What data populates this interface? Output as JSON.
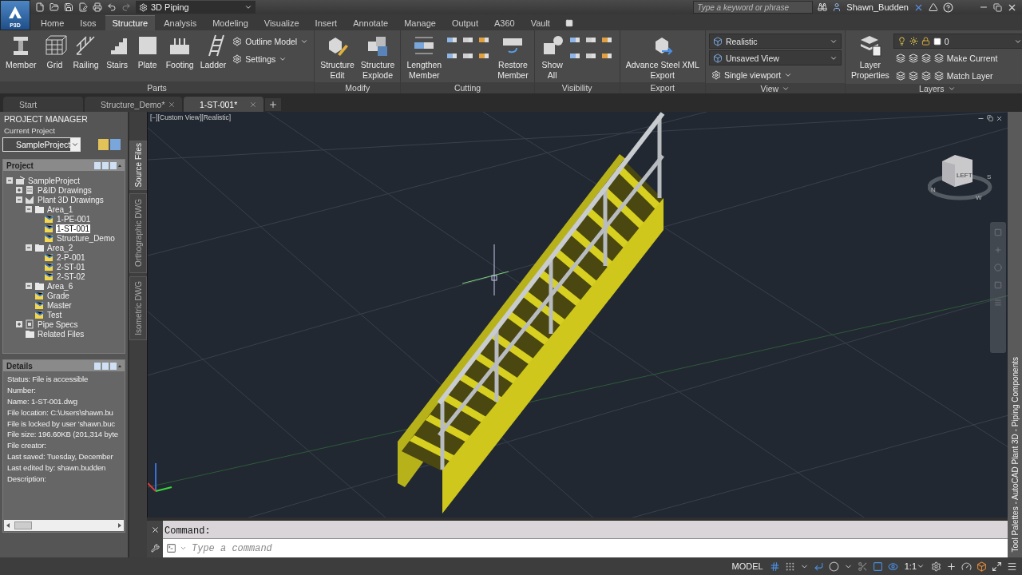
{
  "title_bar": {
    "app_badge": "P3D",
    "workspace": "3D Piping",
    "search_placeholder": "Type a keyword or phrase",
    "user": "Shawn_Budden"
  },
  "ribbon_tabs": [
    {
      "label": "Home",
      "selected": false
    },
    {
      "label": "Isos",
      "selected": false
    },
    {
      "label": "Structure",
      "selected": true
    },
    {
      "label": "Analysis",
      "selected": false
    },
    {
      "label": "Modeling",
      "selected": false
    },
    {
      "label": "Visualize",
      "selected": false
    },
    {
      "label": "Insert",
      "selected": false
    },
    {
      "label": "Annotate",
      "selected": false
    },
    {
      "label": "Manage",
      "selected": false
    },
    {
      "label": "Output",
      "selected": false
    },
    {
      "label": "A360",
      "selected": false
    },
    {
      "label": "Vault",
      "selected": false
    }
  ],
  "ribbon_panels": [
    {
      "title": "Parts",
      "menu": false,
      "tools": [
        {
          "kind": "large",
          "lines": [
            "Member"
          ]
        },
        {
          "kind": "large",
          "lines": [
            "Grid"
          ]
        },
        {
          "kind": "large",
          "lines": [
            "Railing"
          ]
        },
        {
          "kind": "large",
          "lines": [
            "Stairs"
          ]
        },
        {
          "kind": "large",
          "lines": [
            "Plate"
          ]
        },
        {
          "kind": "large",
          "lines": [
            "Footing"
          ]
        },
        {
          "kind": "large",
          "lines": [
            "Ladder"
          ]
        },
        {
          "kind": "stack",
          "items": [
            {
              "kind": "menu",
              "label": "Outline Model"
            },
            {
              "kind": "menu",
              "label": "Settings"
            }
          ]
        }
      ]
    },
    {
      "title": "Modify",
      "menu": false,
      "tools": [
        {
          "kind": "large",
          "lines": [
            "Structure",
            "Edit"
          ]
        },
        {
          "kind": "large",
          "lines": [
            "Structure",
            "Explode"
          ]
        }
      ]
    },
    {
      "title": "Cutting",
      "menu": false,
      "tools": [
        {
          "kind": "large",
          "lines": [
            "Lengthen",
            "Member"
          ]
        },
        {
          "kind": "icon_grid"
        },
        {
          "kind": "large",
          "lines": [
            "Restore",
            "Member"
          ]
        }
      ]
    },
    {
      "title": "Visibility",
      "menu": false,
      "tools": [
        {
          "kind": "large",
          "lines": [
            "Show",
            "All"
          ]
        },
        {
          "kind": "icon_grid"
        }
      ]
    },
    {
      "title": "Export",
      "menu": false,
      "tools": [
        {
          "kind": "large",
          "lines": [
            "Advance Steel XML",
            "Export"
          ]
        }
      ]
    },
    {
      "title": "View",
      "menu": true,
      "tools": [
        {
          "kind": "stack",
          "items": [
            {
              "kind": "combo",
              "label": "Realistic"
            },
            {
              "kind": "combo",
              "label": "Unsaved View"
            },
            {
              "kind": "menu",
              "label": "Single viewport"
            }
          ]
        }
      ]
    },
    {
      "title": "Layers",
      "menu": true,
      "tools": [
        {
          "kind": "large",
          "lines": [
            "Layer",
            "Properties"
          ]
        },
        {
          "kind": "stack",
          "items": [
            {
              "kind": "layer_combo",
              "label": "0"
            },
            {
              "kind": "action_row",
              "label": "Make Current"
            },
            {
              "kind": "action_row",
              "label": "Match Layer"
            }
          ]
        }
      ]
    }
  ],
  "file_tabs": [
    {
      "label": "Start",
      "selected": false,
      "closable": false
    },
    {
      "label": "Structure_Demo*",
      "selected": false,
      "closable": true
    },
    {
      "label": "1-ST-001*",
      "selected": true,
      "closable": true
    }
  ],
  "project_manager": {
    "title": "PROJECT MANAGER",
    "current_label": "Current Project",
    "current_project": "SampleProject",
    "project_title": "Project",
    "tree": [
      {
        "kind": "project",
        "label": "SampleProject",
        "expanded": true,
        "selected": false,
        "children": [
          {
            "kind": "pid",
            "label": "P&ID Drawings",
            "expanded": false,
            "selected": false
          },
          {
            "kind": "plant",
            "label": "Plant 3D Drawings",
            "expanded": true,
            "selected": false,
            "children": [
              {
                "kind": "folder",
                "label": "Area_1",
                "expanded": true,
                "selected": false,
                "children": [
                  {
                    "kind": "drawing",
                    "label": "1-PE-001",
                    "selected": false
                  },
                  {
                    "kind": "drawing",
                    "label": "1-ST-001",
                    "selected": true
                  },
                  {
                    "kind": "drawing",
                    "label": "Structure_Demo",
                    "selected": false
                  }
                ]
              },
              {
                "kind": "folder",
                "label": "Area_2",
                "expanded": true,
                "selected": false,
                "children": [
                  {
                    "kind": "drawing",
                    "label": "2-P-001",
                    "selected": false
                  },
                  {
                    "kind": "drawing",
                    "label": "2-ST-01",
                    "selected": false
                  },
                  {
                    "kind": "drawing",
                    "label": "2-ST-02",
                    "selected": false
                  }
                ]
              },
              {
                "kind": "folder",
                "label": "Area_6",
                "expanded": true,
                "selected": false
              },
              {
                "kind": "drawing",
                "label": "Grade",
                "selected": false
              },
              {
                "kind": "drawing",
                "label": "Master",
                "selected": false
              },
              {
                "kind": "drawing",
                "label": "Test",
                "selected": false
              }
            ]
          },
          {
            "kind": "specs",
            "label": "Pipe Specs",
            "expanded": false,
            "selected": false
          },
          {
            "kind": "folder",
            "label": "Related Files",
            "selected": false
          }
        ]
      }
    ],
    "details_title": "Details",
    "details": [
      "Status: File is accessible",
      "Number:",
      "Name:  1-ST-001.dwg",
      "File location: C:\\Users\\shawn.bu",
      "File is locked by user 'shawn.buc",
      "File size: 196.60KB (201,314 byte",
      "File creator:",
      "Last saved: Tuesday, December",
      "Last edited by: shawn.budden",
      "Description:"
    ]
  },
  "side_tabs": [
    {
      "label": "Source Files",
      "selected": true
    },
    {
      "label": "Orthographic DWG",
      "selected": false
    },
    {
      "label": "Isometric DWG",
      "selected": false
    }
  ],
  "viewport": {
    "label": "[−][Custom View][Realistic]",
    "cube_face": "LEFT",
    "compass": [
      "N",
      "W",
      "S"
    ]
  },
  "command_line": {
    "prompt": "Command:",
    "placeholder": "Type a command"
  },
  "tool_palette_title": "Tool Palettes - AutoCAD Plant 3D - Piping Components",
  "status_bar": {
    "model": "MODEL",
    "scale": "1:1"
  }
}
